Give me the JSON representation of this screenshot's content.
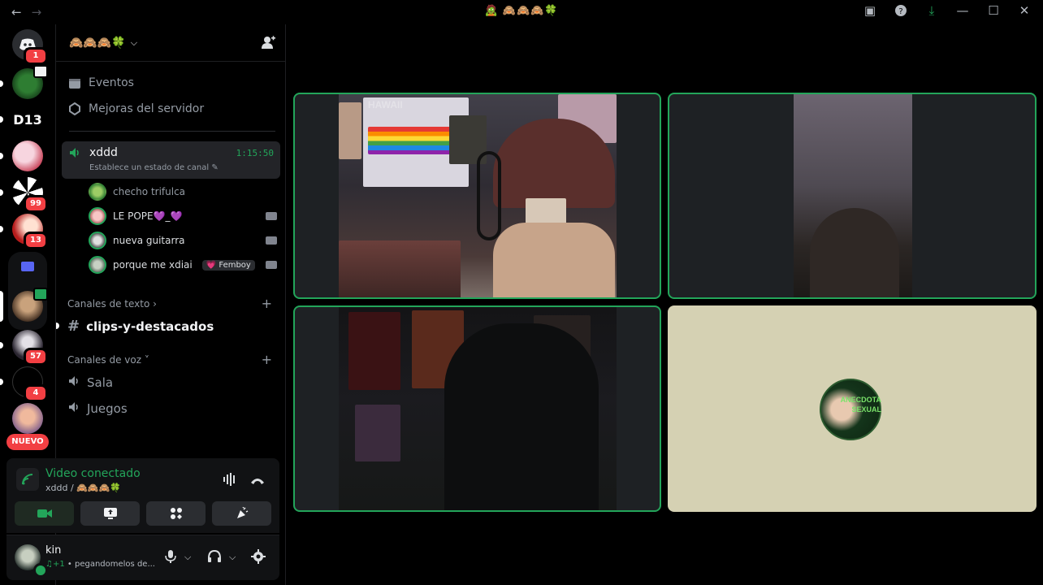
{
  "titlebar": {
    "back": "←",
    "forward": "→",
    "title": "🧟 🙈🙈🙈🍀",
    "icons": [
      "inbox-icon",
      "help-icon",
      "download-icon",
      "minimize-icon",
      "maximize-icon",
      "close-icon"
    ],
    "minimize": "—",
    "maximize": "☐",
    "close": "✕",
    "help": "?",
    "inbox": "▣",
    "download": "⤓"
  },
  "rail": {
    "home_badge": "1",
    "badges": {
      "s5": "99",
      "s6": "13",
      "s9": "57",
      "s10": "4"
    },
    "nuevo": "NUEVO",
    "d13_label": "D13"
  },
  "sidebar": {
    "guild_name": "🙈🙈🙈🍀",
    "top_items": [
      {
        "label": "Eventos",
        "icon": "calendar-icon"
      },
      {
        "label": "Mejoras del servidor",
        "icon": "boost-icon"
      }
    ],
    "active_voice": {
      "name": "xddd",
      "time": "1:15:50",
      "status": "Establece un estado de canal ✎"
    },
    "voice_users": [
      {
        "name": "checho trifulca",
        "camera": false
      },
      {
        "name": "LE POPE💜_💜",
        "camera": true
      },
      {
        "name": "nueva guitarra",
        "camera": true
      },
      {
        "name": "porque me xdiai",
        "tag": "💗 Femboy",
        "camera": true
      }
    ],
    "text_category": "Canales de texto ›",
    "text_channels": [
      {
        "name": "clips-y-destacados",
        "unread": true
      }
    ],
    "voice_category": "Canales de voz ˅",
    "voice_channels": [
      {
        "name": "Sala"
      },
      {
        "name": "Juegos"
      }
    ]
  },
  "rtc": {
    "title": "Video conectado",
    "sub": "xddd / 🙈🙈🙈🍀",
    "buttons": [
      "camera-button",
      "screenshare-button",
      "activities-button",
      "soundboard-button"
    ]
  },
  "user": {
    "name": "kin",
    "status_music": "♫+1",
    "status": "• pegandomelos de..."
  },
  "video": {
    "hawaii": "HAWAII",
    "avatar_text": "ANECDOTA SEXUAL"
  },
  "colors": {
    "accent_green": "#23a55a",
    "badge_red": "#f23f43",
    "tile_bg": "#1e2124",
    "avatar_tile_bg": "#d5d1b3"
  }
}
